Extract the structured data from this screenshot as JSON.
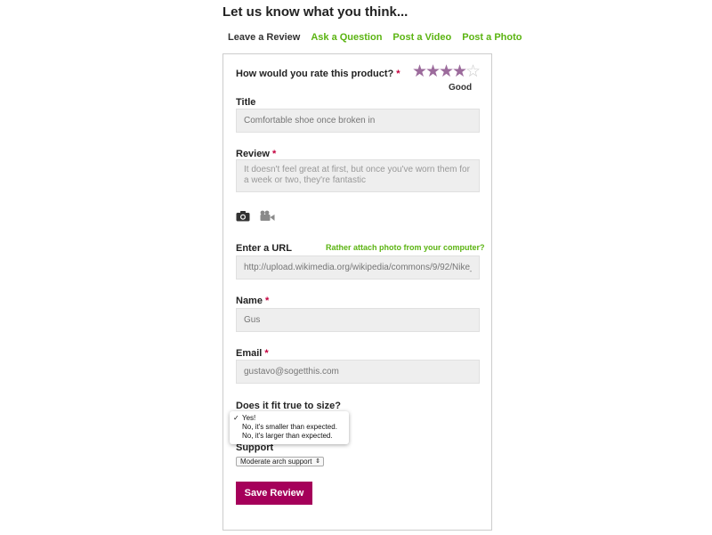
{
  "heading": "Let us know what you think...",
  "tabs": [
    {
      "label": "Leave a Review",
      "active": true
    },
    {
      "label": "Ask a Question",
      "active": false
    },
    {
      "label": "Post a Video",
      "active": false
    },
    {
      "label": "Post a Photo",
      "active": false
    }
  ],
  "rating": {
    "question": "How would you rate this product?",
    "required_marker": "*",
    "value": 4,
    "max": 5,
    "text": "Good"
  },
  "title": {
    "label": "Title",
    "placeholder": "Comfortable shoe once broken in"
  },
  "review": {
    "label": "Review",
    "required_marker": "*",
    "placeholder": "It doesn't feel great at first, but once you've worn them for a week or two, they're fantastic"
  },
  "media_icons": [
    "camera-icon",
    "video-camera-icon"
  ],
  "url": {
    "label": "Enter a URL",
    "link_text": "Rather attach photo from your computer?",
    "placeholder": "http://upload.wikimedia.org/wikipedia/commons/9/92/Nike_"
  },
  "name": {
    "label": "Name",
    "required_marker": "*",
    "placeholder": "Gus"
  },
  "email": {
    "label": "Email",
    "required_marker": "*",
    "placeholder": "gustavo@sogetthis.com"
  },
  "fit": {
    "label": "Does it fit true to size?",
    "options": [
      "Yes!",
      "No, it's smaller than expected.",
      "No, it's larger than expected."
    ],
    "selected_index": 0,
    "check_mark": "✓"
  },
  "support": {
    "label": "Support",
    "selected": "Moderate arch support"
  },
  "save_label": "Save Review",
  "colors": {
    "accent": "#a5005a",
    "link": "#5bb412",
    "star_on": "#9c6b9c",
    "required": "#c4003e"
  }
}
